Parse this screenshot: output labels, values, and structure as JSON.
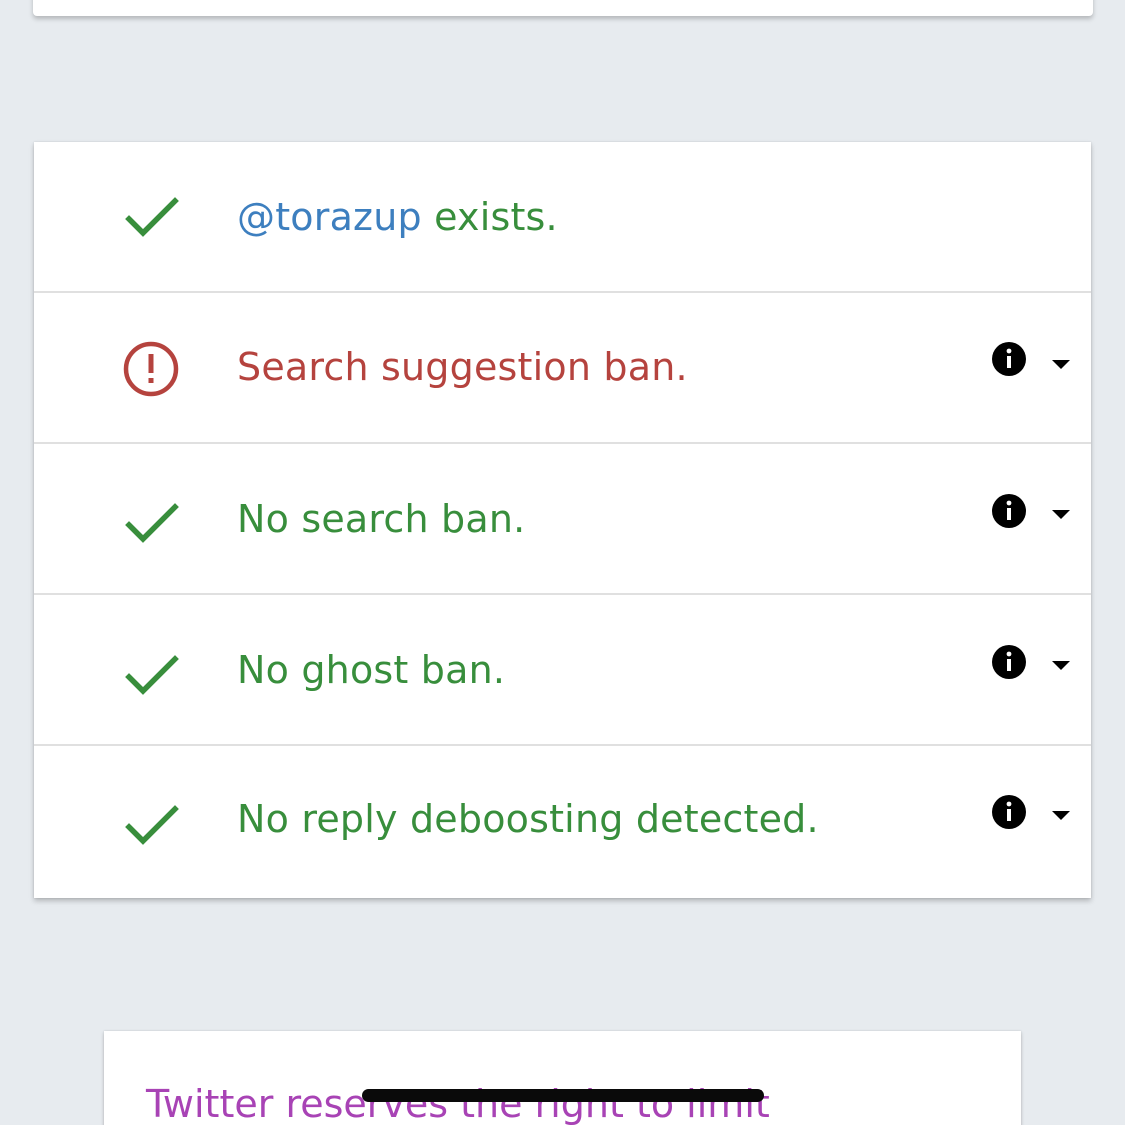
{
  "results": [
    {
      "status": "ok",
      "icon": "check-icon",
      "handle": "@torazup",
      "text": " exists.",
      "has_info": false
    },
    {
      "status": "bad",
      "icon": "alert-circle-icon",
      "text": "Search suggestion ban.",
      "has_info": true
    },
    {
      "status": "ok",
      "icon": "check-icon",
      "text": "No search ban.",
      "has_info": true
    },
    {
      "status": "ok",
      "icon": "check-icon",
      "text": "No ghost ban.",
      "has_info": true
    },
    {
      "status": "ok",
      "icon": "check-icon",
      "text": "No reply deboosting detected.",
      "has_info": true
    }
  ],
  "footer_card": {
    "text": "Twitter reserves the right to limit"
  },
  "colors": {
    "ok": "#388e3c",
    "bad": "#b5433e",
    "handle": "#3d7fbf",
    "footer_text": "#a843b5",
    "background": "#e7ebef"
  }
}
